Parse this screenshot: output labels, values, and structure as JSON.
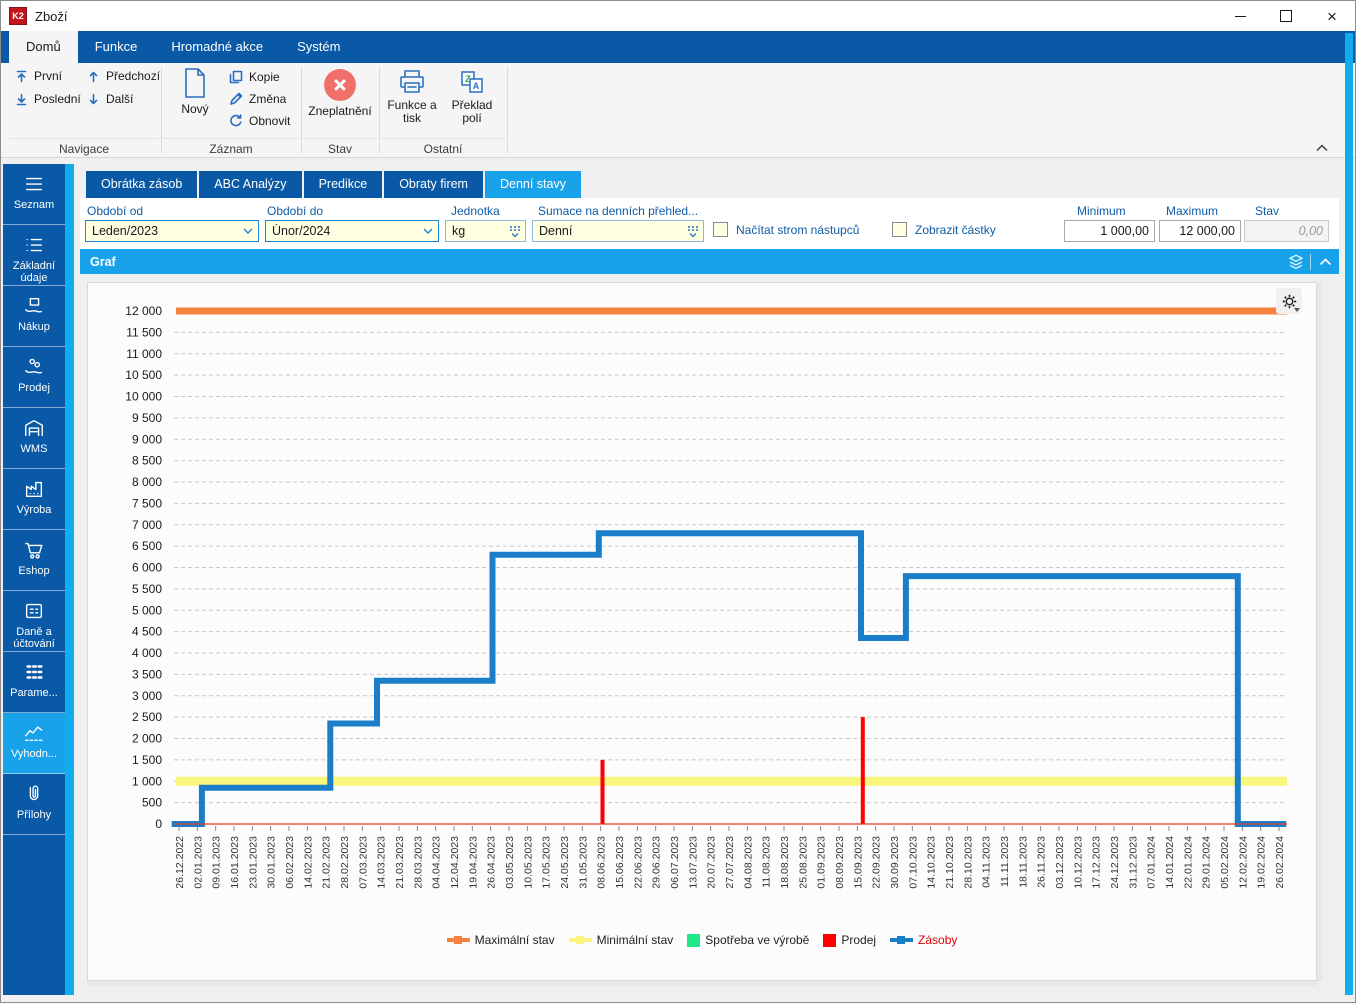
{
  "window": {
    "title": "Zboží",
    "logo_text": "K2",
    "close_glyph": "×"
  },
  "ribbon": {
    "tabs": [
      {
        "label": "Domů",
        "active": true
      },
      {
        "label": "Funkce",
        "active": false
      },
      {
        "label": "Hromadné akce",
        "active": false
      },
      {
        "label": "Systém",
        "active": false
      }
    ],
    "groups": {
      "navigace": {
        "label": "Navigace",
        "buttons": {
          "prvni": "První",
          "posledni": "Poslední",
          "predchozi": "Předchozí",
          "dalsi": "Další"
        }
      },
      "zaznam": {
        "label": "Záznam",
        "buttons": {
          "novy": "Nový",
          "kopie": "Kopie",
          "zmena": "Změna",
          "obnovit": "Obnovit"
        }
      },
      "stav": {
        "label": "Stav",
        "buttons": {
          "zneplatneni": "Zneplatnění"
        }
      },
      "ostatni": {
        "label": "Ostatní",
        "buttons": {
          "funkce_a_tisk": "Funkce a tisk",
          "preklad_poli": "Překlad polí"
        }
      }
    }
  },
  "sidebar": {
    "items": [
      {
        "label": "Seznam",
        "icon": "hamburger-icon",
        "active": false
      },
      {
        "label": "Základní údaje",
        "icon": "list-icon",
        "active": false
      },
      {
        "label": "Nákup",
        "icon": "purchase-icon",
        "active": false
      },
      {
        "label": "Prodej",
        "icon": "sell-icon",
        "active": false
      },
      {
        "label": "WMS",
        "icon": "warehouse-icon",
        "active": false
      },
      {
        "label": "Výroba",
        "icon": "factory-icon",
        "active": false
      },
      {
        "label": "Eshop",
        "icon": "cart-icon",
        "active": false
      },
      {
        "label": "Daně a účtování",
        "icon": "taxes-icon",
        "active": false
      },
      {
        "label": "Parame...",
        "icon": "parameters-icon",
        "active": false
      },
      {
        "label": "Vyhodn...",
        "icon": "evaluation-icon",
        "active": true
      },
      {
        "label": "Přílohy",
        "icon": "paperclip-icon",
        "active": false
      }
    ]
  },
  "tabs": [
    {
      "label": "Obrátka zásob",
      "active": false
    },
    {
      "label": "ABC Analýzy",
      "active": false
    },
    {
      "label": "Predikce",
      "active": false
    },
    {
      "label": "Obraty firem",
      "active": false
    },
    {
      "label": "Denní stavy",
      "active": true
    }
  ],
  "filters": {
    "obdobi_od": {
      "label": "Období od",
      "value": "Leden/2023"
    },
    "obdobi_do": {
      "label": "Období do",
      "value": "Únor/2024"
    },
    "jednotka": {
      "label": "Jednotka",
      "value": "kg"
    },
    "sumace": {
      "label": "Sumace na denních přehled...",
      "value": "Denní"
    },
    "nacitat_strom": {
      "label": "Načítat strom nástupců",
      "checked": false
    },
    "zobrazit_castky": {
      "label": "Zobrazit částky",
      "checked": false
    },
    "minimum": {
      "label": "Minimum",
      "value": "1 000,00"
    },
    "maximum": {
      "label": "Maximum",
      "value": "12 000,00"
    },
    "stav": {
      "label": "Stav",
      "value": "0,00"
    }
  },
  "graf_panel": {
    "title": "Graf"
  },
  "chart_data": {
    "type": "line",
    "title": "Graf",
    "y_axis": {
      "min": 0,
      "max": 12000,
      "step": 500
    },
    "x_axis": {
      "labels_rotated": true
    },
    "legend_position": "bottom",
    "grid": true,
    "categories": [
      "26.12.2022",
      "02.01.2023",
      "09.01.2023",
      "16.01.2023",
      "23.01.2023",
      "30.01.2023",
      "06.02.2023",
      "14.02.2023",
      "21.02.2023",
      "28.02.2023",
      "07.03.2023",
      "14.03.2023",
      "21.03.2023",
      "28.03.2023",
      "04.04.2023",
      "12.04.2023",
      "19.04.2023",
      "26.04.2023",
      "03.05.2023",
      "10.05.2023",
      "17.05.2023",
      "24.05.2023",
      "31.05.2023",
      "08.06.2023",
      "15.06.2023",
      "22.06.2023",
      "29.06.2023",
      "06.07.2023",
      "13.07.2023",
      "20.07.2023",
      "27.07.2023",
      "04.08.2023",
      "11.08.2023",
      "18.08.2023",
      "25.08.2023",
      "01.09.2023",
      "08.09.2023",
      "15.09.2023",
      "22.09.2023",
      "30.09.2023",
      "07.10.2023",
      "14.10.2023",
      "21.10.2023",
      "28.10.2023",
      "04.11.2023",
      "11.11.2023",
      "18.11.2023",
      "26.11.2023",
      "03.12.2023",
      "10.12.2023",
      "17.12.2023",
      "24.12.2023",
      "31.12.2023",
      "07.01.2024",
      "14.01.2024",
      "22.01.2024",
      "29.01.2024",
      "05.02.2024",
      "12.02.2024",
      "19.02.2024",
      "26.02.2024"
    ],
    "series": [
      {
        "name": "Maximální stav",
        "type": "hline",
        "value": 12000,
        "color": "#F5823E",
        "width": 7
      },
      {
        "name": "Minimální stav",
        "type": "hline",
        "value": 1000,
        "color": "#FAF57D",
        "width": 9
      },
      {
        "name": "Spotřeba ve výrobě",
        "type": "bar",
        "color": "#1FE88A",
        "points": []
      },
      {
        "name": "Prodej",
        "type": "bar",
        "color": "#FF0000",
        "points": [
          {
            "x": 23.1,
            "value": 1500
          },
          {
            "x": 37.3,
            "value": 2500
          }
        ]
      },
      {
        "name": "Zásoby",
        "type": "step",
        "color": "#1B7EC8",
        "label_color": "#E00000",
        "points": [
          [
            -0.4,
            0
          ],
          [
            1.25,
            0
          ],
          [
            1.25,
            850
          ],
          [
            8.25,
            850
          ],
          [
            8.25,
            2350
          ],
          [
            10.8,
            2350
          ],
          [
            10.8,
            3350
          ],
          [
            17.1,
            3350
          ],
          [
            17.1,
            6300
          ],
          [
            22.9,
            6300
          ],
          [
            22.9,
            6800
          ],
          [
            37.2,
            6800
          ],
          [
            37.2,
            4350
          ],
          [
            39.65,
            4350
          ],
          [
            39.65,
            5800
          ],
          [
            57.75,
            5800
          ],
          [
            57.75,
            0
          ],
          [
            60.4,
            0
          ]
        ]
      }
    ]
  }
}
